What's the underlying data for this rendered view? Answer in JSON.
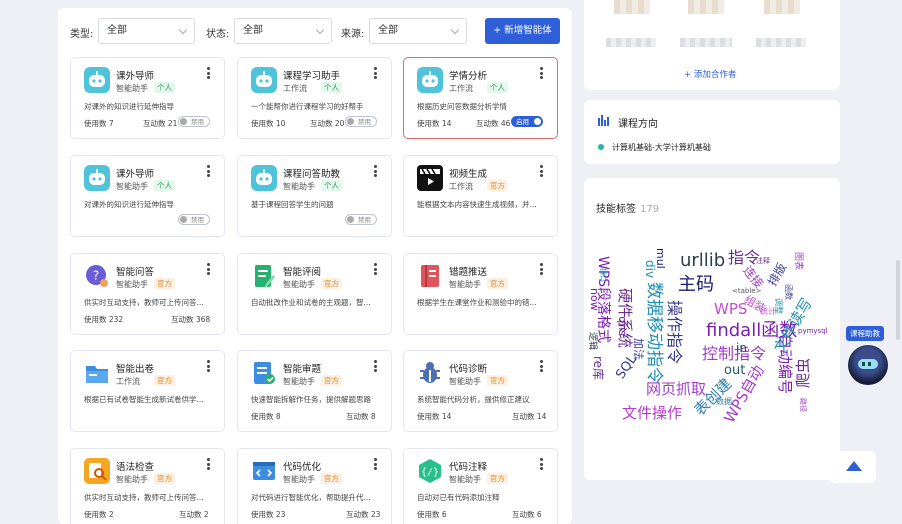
{
  "filters": {
    "type_label": "类型:",
    "type_value": "全部",
    "status_label": "状态:",
    "status_value": "全部",
    "source_label": "来源:",
    "source_value": "全部",
    "add_button": "+ 新增智能体"
  },
  "cards": [
    {
      "name": "课外导师",
      "type": "智能助手",
      "tag": "个人",
      "desc": "对课外的知识进行延伸指导",
      "usage": "使用数 7",
      "interact": "互动数 21",
      "toggle": "禁用",
      "icon": "robot-icon"
    },
    {
      "name": "课程学习助手",
      "type": "工作流",
      "tag": "个人",
      "desc": "一个能帮你进行课程学习的好帮手",
      "usage": "使用数 10",
      "interact": "互动数 20",
      "toggle": "禁用",
      "icon": "robot-icon"
    },
    {
      "name": "学情分析",
      "type": "工作流",
      "tag": "个人",
      "desc": "根据历史问答数据分析学情",
      "usage": "使用数 14",
      "interact": "互动数 46",
      "toggle": "启用",
      "icon": "robot-icon"
    },
    {
      "name": "课外导师",
      "type": "智能助手",
      "tag": "个人",
      "desc": "对课外的知识进行延伸指导",
      "usage": "",
      "interact": "",
      "toggle": "禁用",
      "icon": "robot-icon"
    },
    {
      "name": "课程问答助教",
      "type": "智能助手",
      "tag": "个人",
      "desc": "基于课程回答学生的问题",
      "usage": "",
      "interact": "",
      "toggle": "禁用",
      "icon": "robot-icon"
    },
    {
      "name": "视频生成",
      "type": "工作流",
      "tag": "官方",
      "desc": "能根据文本内容快速生成视频，并...",
      "usage": "",
      "interact": "",
      "toggle": "",
      "icon": "clapperboard-icon"
    },
    {
      "name": "智能问答",
      "type": "智能助手",
      "tag": "官方",
      "desc": "供实时互动支持，教师可上传问答...",
      "usage": "使用数 232",
      "interact": "互动数 368",
      "toggle": "",
      "icon": "question-bubble-icon"
    },
    {
      "name": "智能评阅",
      "type": "智能助手",
      "tag": "官方",
      "desc": "自动批改作业和试卷的主观题，智...",
      "usage": "",
      "interact": "",
      "toggle": "",
      "icon": "pen-document-icon"
    },
    {
      "name": "错题推送",
      "type": "智能助手",
      "tag": "官方",
      "desc": "根据学生在课堂作业和测验中的错...",
      "usage": "",
      "interact": "",
      "toggle": "",
      "icon": "notebook-icon"
    },
    {
      "name": "智能出卷",
      "type": "工作流",
      "tag": "官方",
      "desc": "根据已有试卷智能生成新试卷供学...",
      "usage": "",
      "interact": "",
      "toggle": "",
      "icon": "folder-icon"
    },
    {
      "name": "智能审题",
      "type": "智能助手",
      "tag": "官方",
      "desc": "快速智能拆解作任务，提供解题思路",
      "usage": "使用数 8",
      "interact": "互动数 8",
      "toggle": "",
      "icon": "checklist-icon"
    },
    {
      "name": "代码诊断",
      "type": "智能助手",
      "tag": "官方",
      "desc": "系统智能代码分析，提供修正建议",
      "usage": "使用数 14",
      "interact": "互动数 14",
      "toggle": "",
      "icon": "bug-icon"
    },
    {
      "name": "语法检查",
      "type": "智能助手",
      "tag": "官方",
      "desc": "供实时互动支持，教师可上传问答...",
      "usage": "使用数 2",
      "interact": "互动数 2",
      "toggle": "",
      "icon": "magnifier-doc-icon"
    },
    {
      "name": "代码优化",
      "type": "智能助手",
      "tag": "官方",
      "desc": "对代码进行智能优化，帮助提升代...",
      "usage": "使用数 23",
      "interact": "互动数 23",
      "toggle": "",
      "icon": "code-window-icon"
    },
    {
      "name": "代码注释",
      "type": "智能助手",
      "tag": "官方",
      "desc": "自动对已有代码添加注释",
      "usage": "使用数 6",
      "interact": "互动数 6",
      "toggle": "",
      "icon": "code-brace-icon"
    }
  ],
  "right": {
    "add_collaborator": "+ 添加合作者",
    "course_direction_title": "课程方向",
    "course_name": "计算机基础-大学计算机基础",
    "skill_tags_title": "技能标签",
    "skill_tags_count": "179",
    "assistant_label": "课程助教"
  },
  "word_cloud": [
    {
      "t": "urllib",
      "c": "#2c3e50"
    },
    {
      "t": "主码",
      "c": "#1a1a6e"
    },
    {
      "t": "指令",
      "c": "#6b2d8f"
    },
    {
      "t": "WPS",
      "c": "#c34bd6"
    },
    {
      "t": "findall函数",
      "c": "#7a1fb2"
    },
    {
      "t": "控制指令",
      "c": "#9b3fc7"
    },
    {
      "t": "out",
      "c": "#1d5a63"
    },
    {
      "t": "数据移动指令",
      "c": "#1e8fb5"
    },
    {
      "t": "操作指令",
      "c": "#3b3b8f"
    },
    {
      "t": "硬件系统",
      "c": "#6b2d8f"
    },
    {
      "t": "网页抓取",
      "c": "#a23ec6"
    },
    {
      "t": "文件操作",
      "c": "#b93bd1"
    },
    {
      "t": "表创建",
      "c": "#2c7db3"
    },
    {
      "t": "自动编号",
      "c": "#7a1fb2"
    },
    {
      "t": "文件读写",
      "c": "#1e8fb5"
    },
    {
      "t": "爬虫",
      "c": "#6b2d8f"
    },
    {
      "t": "WPS自动",
      "c": "#a23ec6"
    },
    {
      "t": "WPS段落格式",
      "c": "#7a1fb2"
    },
    {
      "t": "SQL",
      "c": "#3b3b8f"
    },
    {
      "t": "re库",
      "c": "#6b2d8f"
    },
    {
      "t": "组装",
      "c": "#c34bd6"
    },
    {
      "t": "连接",
      "c": "#9b3fc7"
    },
    {
      "t": "排版",
      "c": "#3b3b8f"
    },
    {
      "t": "div",
      "c": "#1e8fb5"
    },
    {
      "t": "sub",
      "c": "#6b2d8f"
    },
    {
      "t": "mul",
      "c": "#1a1a6e"
    },
    {
      "t": "now",
      "c": "#7a1fb2"
    },
    {
      "t": "加法",
      "c": "#3b3b8f"
    },
    {
      "t": "in",
      "c": "#1d5a63"
    },
    {
      "t": "逻辑",
      "c": "#2c3e50"
    },
    {
      "t": "图表",
      "c": "#9b3fc7"
    },
    {
      "t": "<table>",
      "c": "#555555"
    },
    {
      "t": "注释",
      "c": "#6b2d8f"
    },
    {
      "t": "pymysql",
      "c": "#7a1fb2"
    },
    {
      "t": "接口",
      "c": "#1e8fb5"
    },
    {
      "t": "函数",
      "c": "#3b3b8f"
    },
    {
      "t": "统计",
      "c": "#c34bd6"
    },
    {
      "t": "调整",
      "c": "#1e8fb5"
    },
    {
      "t": "路径",
      "c": "#9b3fc7"
    },
    {
      "t": "数据",
      "c": "#2c7db3"
    }
  ]
}
